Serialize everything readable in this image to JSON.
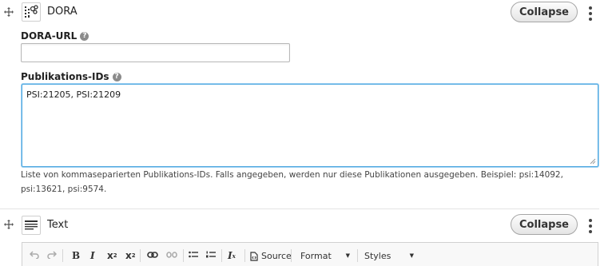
{
  "paragraphs": [
    {
      "type_icon": "dora-icon",
      "title": "DORA",
      "collapse_label": "Collapse",
      "fields": {
        "dora_url": {
          "label": "DORA-URL",
          "value": "",
          "placeholder": ""
        },
        "publication_ids": {
          "label": "Publikations-IDs",
          "value": "PSI:21205, PSI:21209",
          "description": "Liste von kommaseparierten Publikations-IDs. Falls angegeben, werden nur diese Publikationen ausgegeben. Beispiel: psi:14092, psi:13621, psi:9574."
        }
      }
    },
    {
      "type_icon": "text-paragraph-icon",
      "title": "Text",
      "collapse_label": "Collapse",
      "editor_toolbar": {
        "source_label": "Source",
        "format_label": "Format",
        "styles_label": "Styles",
        "buttons": [
          "undo",
          "redo",
          "bold",
          "italic",
          "superscript",
          "subscript",
          "link",
          "unlink",
          "bulleted-list",
          "numbered-list",
          "remove-format",
          "source"
        ]
      }
    }
  ],
  "colors": {
    "focus_border": "#4fa8e0",
    "button_border": "#a6a6a6"
  }
}
